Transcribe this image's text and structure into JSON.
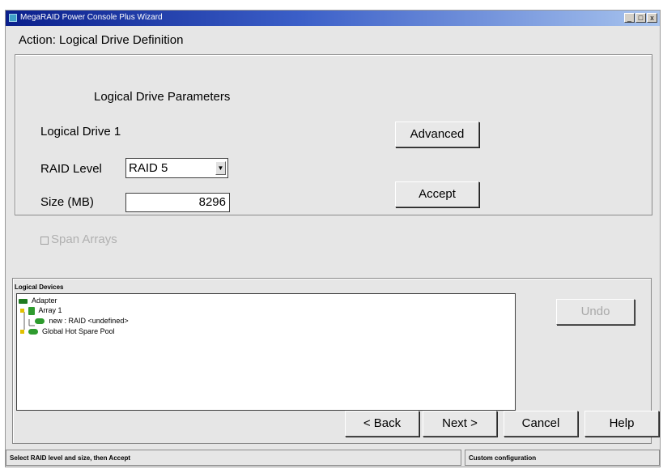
{
  "window": {
    "title": "MegaRAID Power Console Plus Wizard",
    "minimize": "_",
    "maximize": "□",
    "close": "x"
  },
  "action_label": "Action: Logical Drive Definition",
  "params": {
    "heading": "Logical Drive Parameters",
    "drive_label": "Logical Drive 1",
    "raid_level_label": "RAID Level",
    "raid_level_value": "RAID 5",
    "size_label": "Size (MB)",
    "size_value": "8296",
    "advanced_button": "Advanced",
    "accept_button": "Accept"
  },
  "span_arrays_label": "Span Arrays",
  "logical_devices": {
    "title": "Logical Devices",
    "undo_button": "Undo",
    "tree": [
      {
        "label": "Adapter",
        "icon": "adapter-icon"
      },
      {
        "label": "Array 1",
        "icon": "array-icon"
      },
      {
        "label": "new : RAID <undefined>",
        "icon": "logical-drive-icon"
      },
      {
        "label": "Global Hot Spare Pool",
        "icon": "hot-spare-icon"
      }
    ]
  },
  "nav": {
    "back": "< Back",
    "next": "Next >",
    "cancel": "Cancel",
    "help": "Help"
  },
  "status": {
    "left": "Select RAID level and size, then Accept",
    "right": "Custom configuration"
  },
  "colors": {
    "title_bar": "#0a1f8c",
    "icon_green": "#2e9b2e",
    "face": "#e6e6e6"
  }
}
